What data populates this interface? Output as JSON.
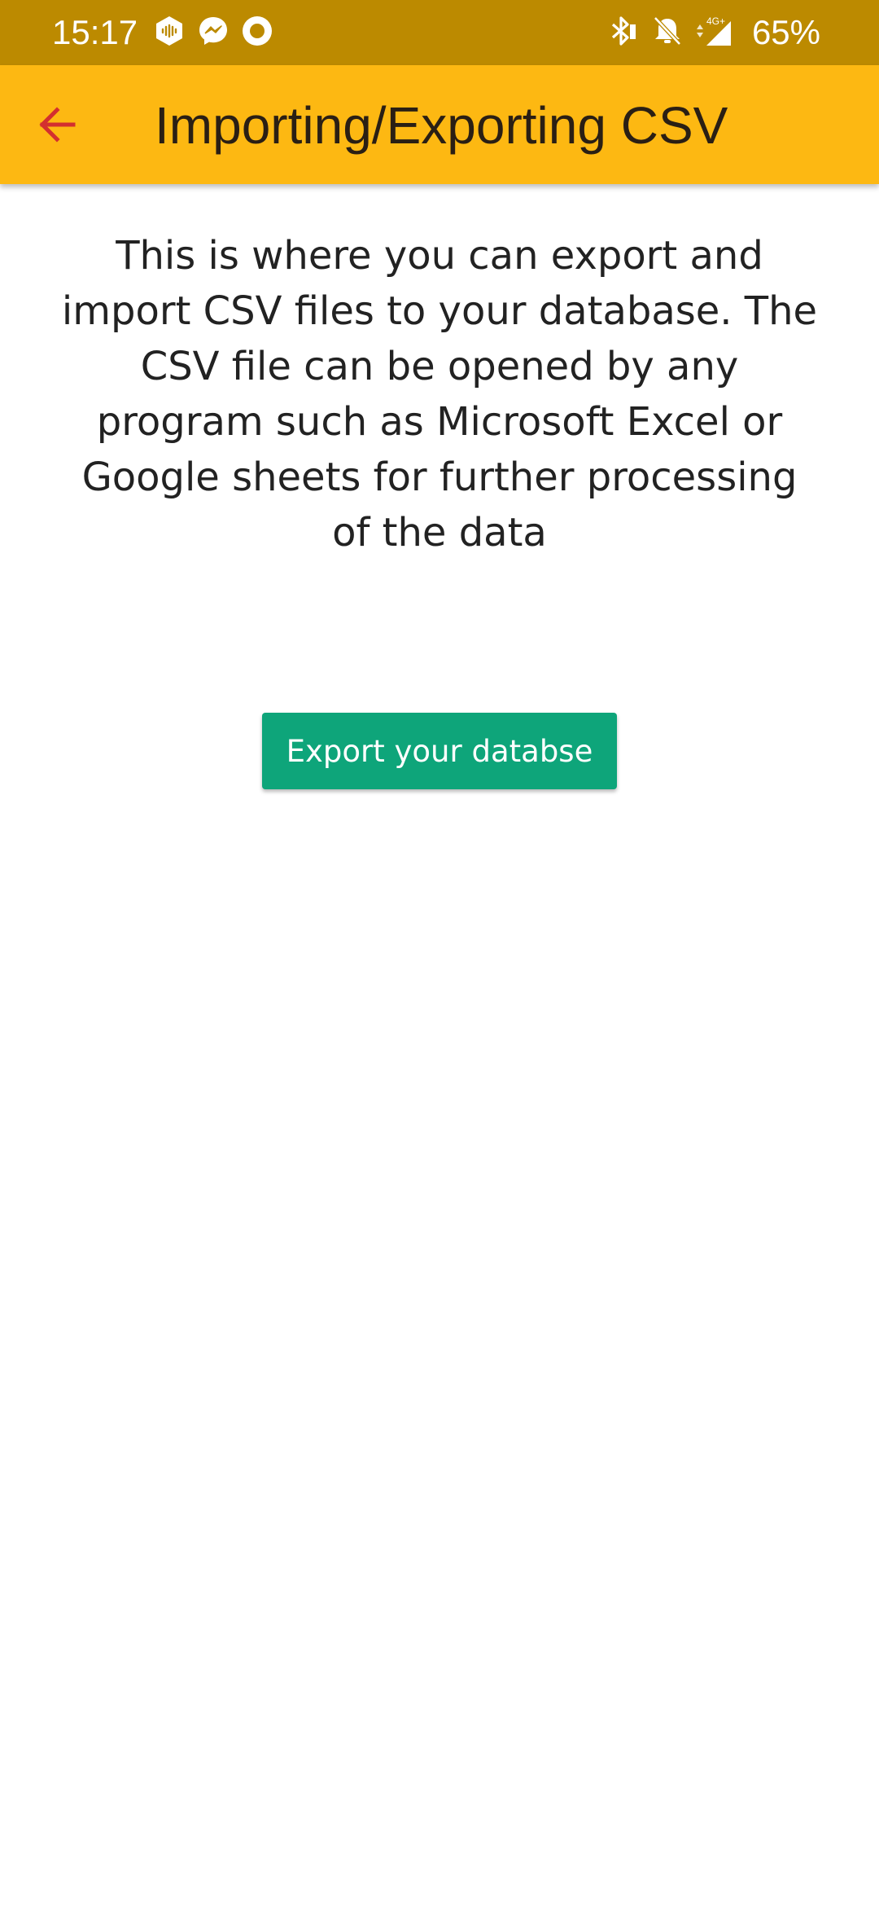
{
  "status_bar": {
    "time": "15:17",
    "battery": "65%",
    "network_label": "4G+",
    "left_icons": [
      "audiomack-icon",
      "messenger-icon",
      "record-circle-icon"
    ],
    "right_icons": [
      "bluetooth-icon",
      "bell-muted-icon",
      "signal-icon",
      "battery-icon"
    ],
    "background_color": "#BC8A00"
  },
  "app_bar": {
    "title": "Importing/Exporting CSV",
    "back_icon": "arrow-left-icon",
    "background_color": "#FDB812",
    "back_icon_color": "#D32F2F"
  },
  "main": {
    "description": "This is where you can export and import CSV files to your database. The CSV file can be opened by any program such as Microsoft Excel or Google sheets for further processing of the data",
    "export_button_label": "Export your databse",
    "export_button_color": "#0EA57A"
  }
}
